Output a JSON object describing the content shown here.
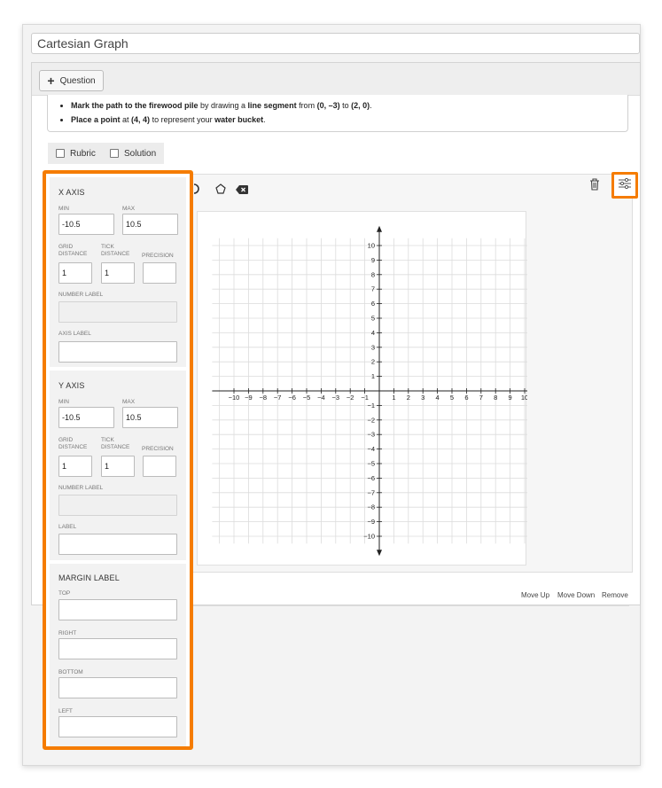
{
  "window": {
    "title_value": "Cartesian Graph"
  },
  "toolbar": {
    "question_label": "Question"
  },
  "stem": {
    "item1_bold1": "Mark the path to the firewood pile",
    "item1_text1": " by drawing a ",
    "item1_bold2": "line segment",
    "item1_text2": " from ",
    "item1_bold3": "(0, –3)",
    "item1_text3": " to ",
    "item1_bold4": "(2, 0)",
    "item1_text4": ".",
    "item2_bold1": "Place a point",
    "item2_text1": " at ",
    "item2_bold2": "(4, 4)",
    "item2_text2": " to represent your ",
    "item2_bold3": "water bucket",
    "item2_text3": "."
  },
  "toggles": {
    "rubric_label": "Rubric",
    "solution_label": "Solution"
  },
  "footer": {
    "move_up": "Move Up",
    "move_down": "Move Down",
    "remove": "Remove"
  },
  "settings": {
    "x_axis": {
      "title": "X AXIS",
      "min_label": "MIN",
      "max_label": "MAX",
      "min_value": "-10.5",
      "max_value": "10.5",
      "grid_label": "GRID DISTANCE",
      "tick_label": "TICK DISTANCE",
      "precision_label": "PRECISION",
      "grid_value": "1",
      "tick_value": "1",
      "precision_value": "",
      "number_label": "NUMBER LABEL",
      "axis_label": "AXIS LABEL"
    },
    "y_axis": {
      "title": "Y AXIS",
      "min_label": "MIN",
      "max_label": "MAX",
      "min_value": "-10.5",
      "max_value": "10.5",
      "grid_label": "GRID DISTANCE",
      "tick_label": "TICK DISTANCE",
      "precision_label": "PRECISION",
      "grid_value": "1",
      "tick_value": "1",
      "precision_value": "",
      "number_label": "NUMBER LABEL",
      "label": "LABEL"
    },
    "margin": {
      "title": "MARGIN LABEL",
      "top": "TOP",
      "right": "RIGHT",
      "bottom": "BOTTOM",
      "left": "LEFT"
    }
  },
  "graph": {
    "x_ticks": [
      "-10",
      "-9",
      "-8",
      "-7",
      "-6",
      "-5",
      "-4",
      "-3",
      "-2",
      "-1",
      "1",
      "2",
      "3",
      "4",
      "5",
      "6",
      "7",
      "8",
      "9",
      "10"
    ],
    "y_ticks": [
      "10",
      "9",
      "8",
      "7",
      "6",
      "5",
      "4",
      "3",
      "2",
      "1",
      "-1",
      "-2",
      "-3",
      "-4",
      "-5",
      "-6",
      "-7",
      "-8",
      "-9",
      "-10"
    ],
    "x_range": [
      -10.5,
      10.5
    ],
    "y_range": [
      -10.5,
      10.5
    ],
    "visible_x_range": [
      -11.5,
      11
    ]
  },
  "colors": {
    "accent": "#f57c00",
    "grid": "#dcdcdc",
    "axis": "#222222"
  }
}
